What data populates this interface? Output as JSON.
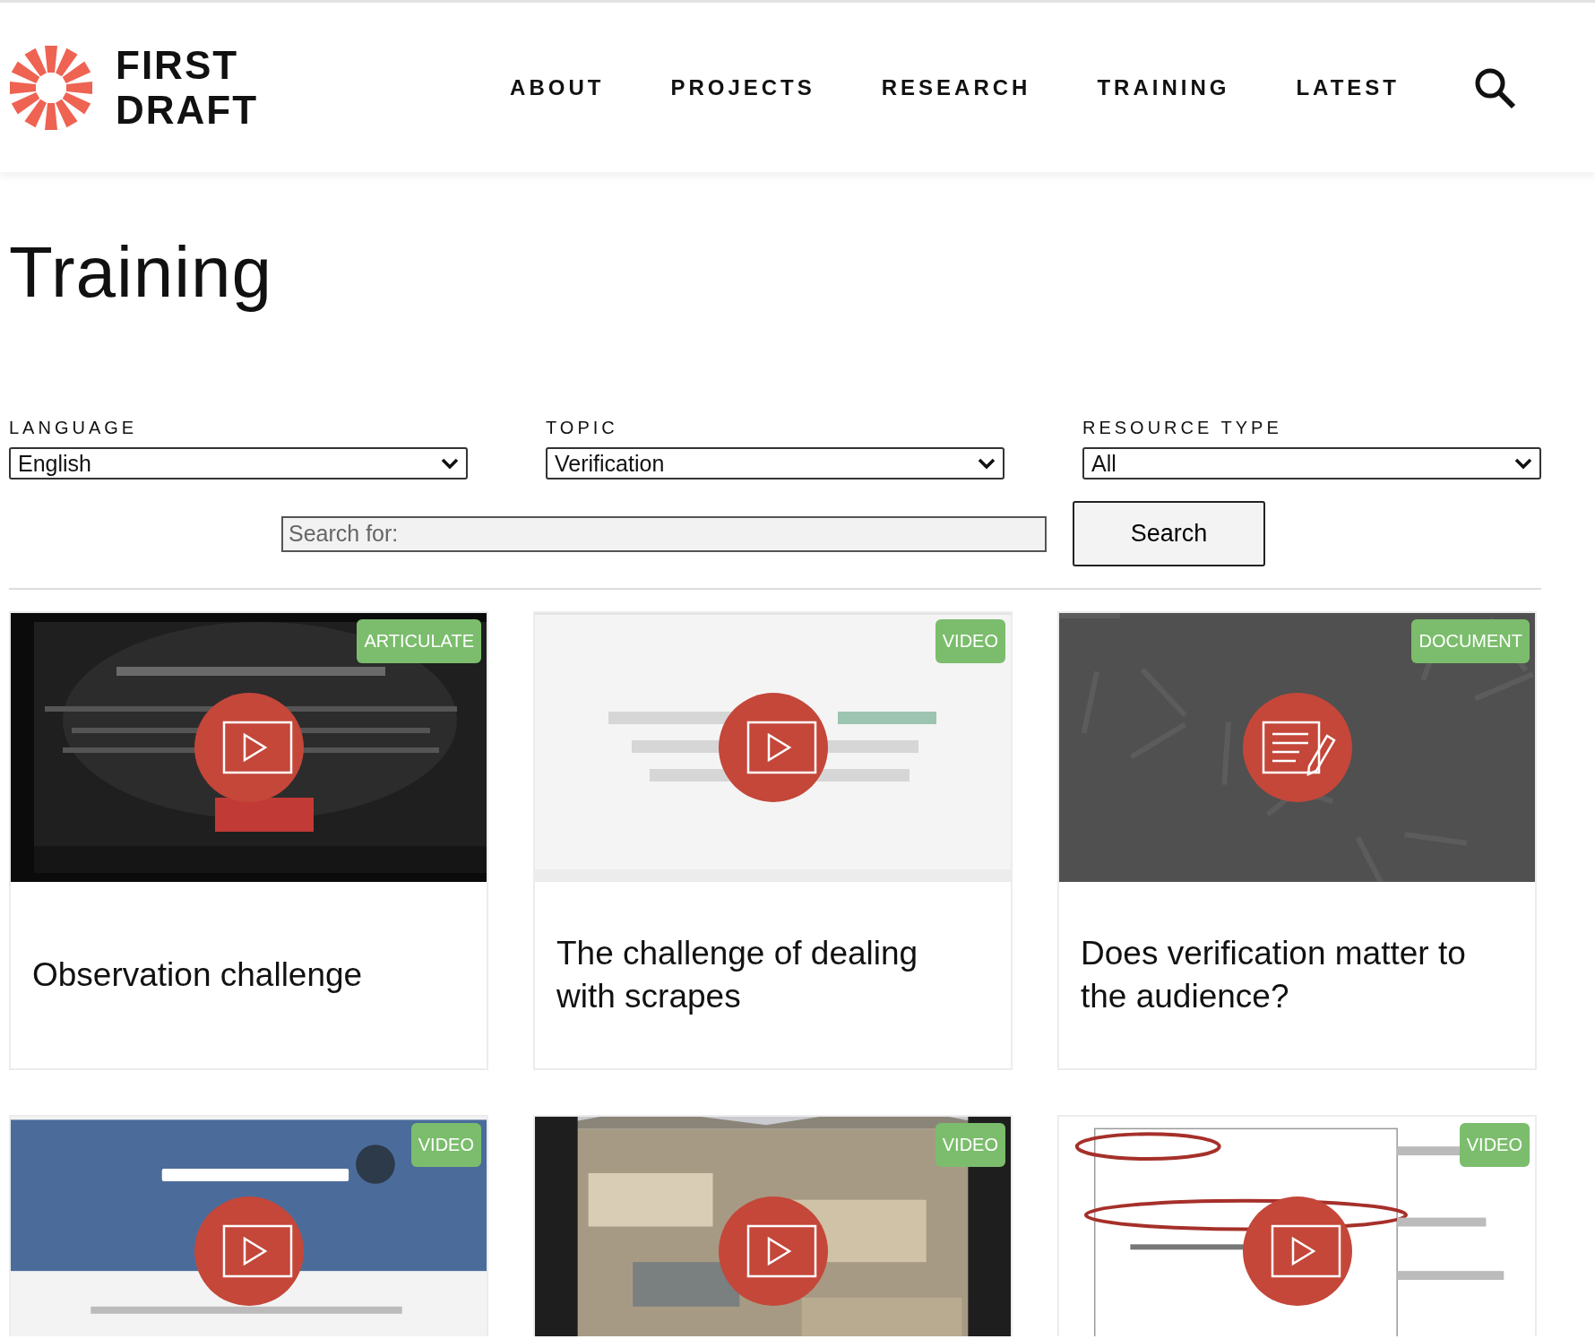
{
  "header": {
    "logo_text": [
      "FIRST",
      "DRAFT"
    ],
    "nav": [
      {
        "label": "ABOUT",
        "selected": false
      },
      {
        "label": "PROJECTS",
        "selected": false
      },
      {
        "label": "RESEARCH",
        "selected": false
      },
      {
        "label": "TRAINING",
        "selected": false
      },
      {
        "label": "LATEST",
        "selected": false
      }
    ]
  },
  "page_title": "Training",
  "filters": [
    {
      "label": "LANGUAGE",
      "value": "English"
    },
    {
      "label": "TOPIC",
      "value": "Verification"
    },
    {
      "label": "RESOURCE TYPE",
      "value": "All"
    }
  ],
  "search": {
    "placeholder": "Search for:",
    "button": "Search"
  },
  "cards": [
    {
      "badge": "ARTICULATE",
      "kind": "play",
      "title": "Observation challenge"
    },
    {
      "badge": "VIDEO",
      "kind": "play",
      "title": "The challenge of dealing with scrapes"
    },
    {
      "badge": "DOCUMENT",
      "kind": "document",
      "title": "Does verification matter to the audience?"
    },
    {
      "badge": "VIDEO",
      "kind": "play"
    },
    {
      "badge": "VIDEO",
      "kind": "play"
    },
    {
      "badge": "VIDEO",
      "kind": "play"
    }
  ]
}
